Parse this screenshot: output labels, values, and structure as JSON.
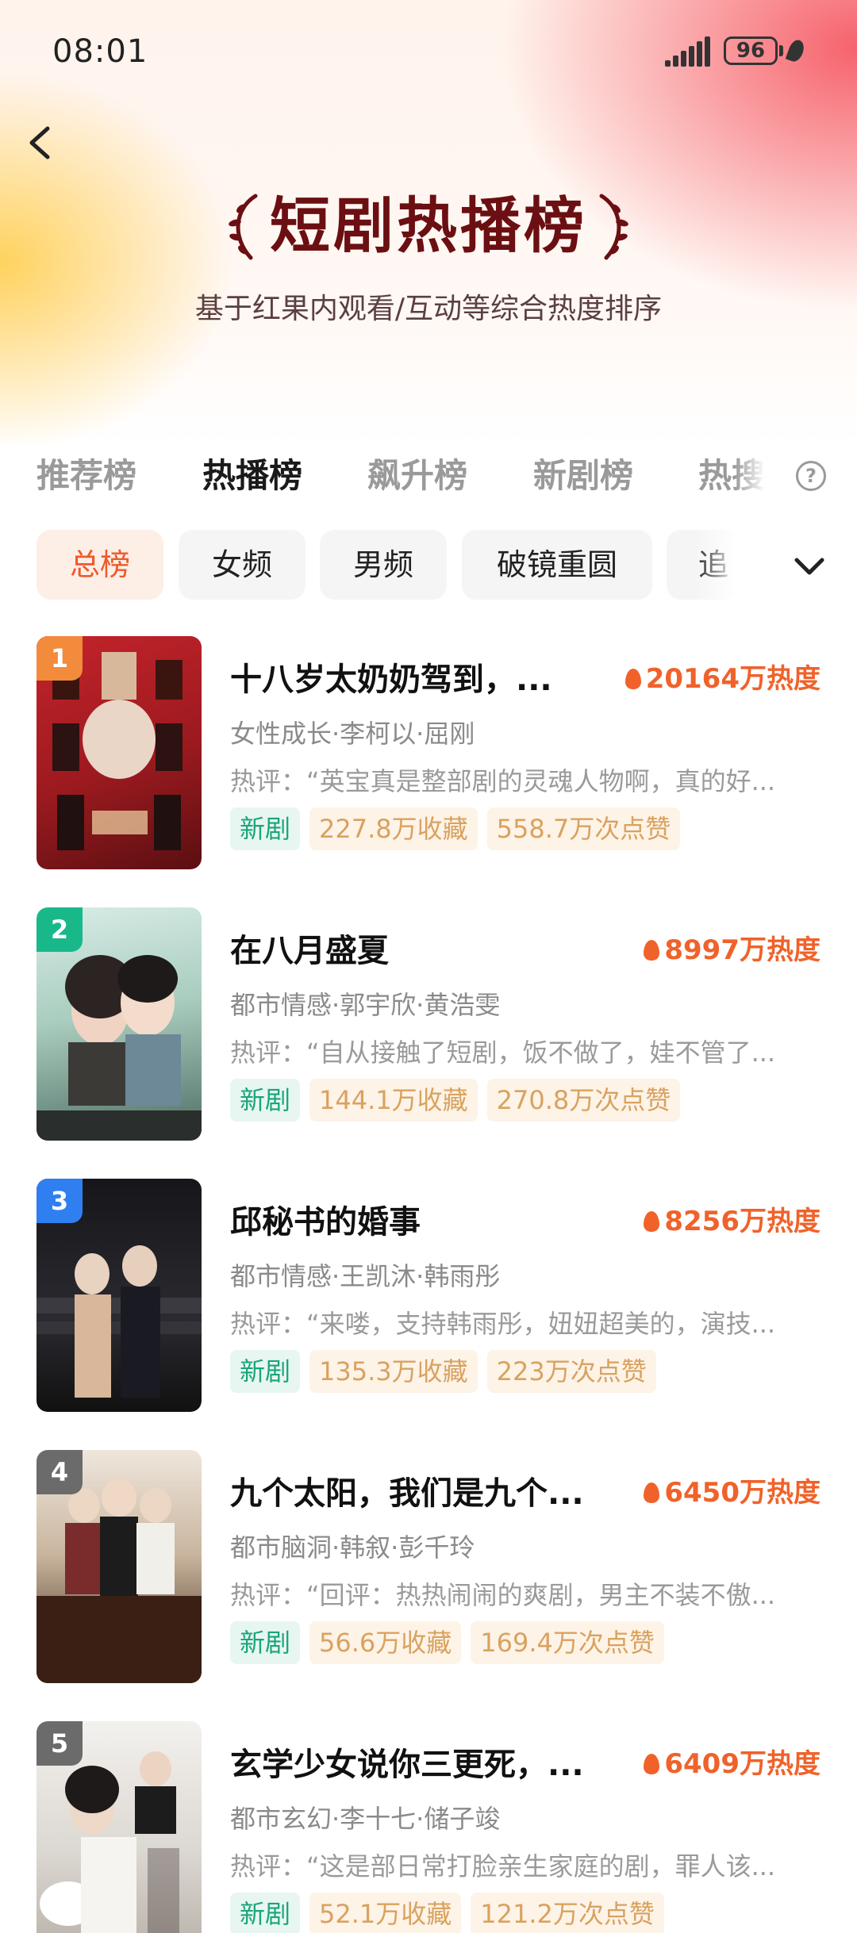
{
  "status_bar": {
    "time": "08:01",
    "battery": "96"
  },
  "header": {
    "title": "短剧热播榜",
    "subtitle": "基于红果内观看/互动等综合热度排序"
  },
  "tabs": [
    {
      "label": "推荐榜",
      "active": false
    },
    {
      "label": "热播榜",
      "active": true
    },
    {
      "label": "飙升榜",
      "active": false
    },
    {
      "label": "新剧榜",
      "active": false
    },
    {
      "label": "热搜",
      "active": false
    }
  ],
  "filters": [
    {
      "label": "总榜",
      "active": true
    },
    {
      "label": "女频",
      "active": false
    },
    {
      "label": "男频",
      "active": false
    },
    {
      "label": "破镜重圆",
      "active": false
    },
    {
      "label": "追",
      "active": false
    }
  ],
  "colors": {
    "accent": "#f0622a",
    "title_dark_red": "#6b0f12",
    "rank1": "#f28b3c",
    "rank2": "#19b88a",
    "rank3": "#2f7ff0",
    "rank_other": "#6b6b6b",
    "tag_new": "#1aa57a",
    "tag_stat": "#d9a25f"
  },
  "items": [
    {
      "rank": "1",
      "title": "十八岁太奶奶驾到，...",
      "heat": "20164万热度",
      "meta": "女性成长·李柯以·屈刚",
      "review": "热评：“英宝真是整部剧的灵魂人物啊，真的好...",
      "tags": [
        "新剧",
        "227.8万收藏",
        "558.7万次点赞"
      ]
    },
    {
      "rank": "2",
      "title": "在八月盛夏",
      "heat": "8997万热度",
      "meta": "都市情感·郭宇欣·黄浩雯",
      "review": "热评：“自从接触了短剧，饭不做了，娃不管了...",
      "tags": [
        "新剧",
        "144.1万收藏",
        "270.8万次点赞"
      ]
    },
    {
      "rank": "3",
      "title": "邱秘书的婚事",
      "heat": "8256万热度",
      "meta": "都市情感·王凯沐·韩雨彤",
      "review": "热评：“来喽，支持韩雨彤，妞妞超美的，演技...",
      "tags": [
        "新剧",
        "135.3万收藏",
        "223万次点赞"
      ]
    },
    {
      "rank": "4",
      "title": "九个太阳，我们是九个...",
      "heat": "6450万热度",
      "meta": "都市脑洞·韩叙·彭千玲",
      "review": "热评：“回评：热热闹闹的爽剧，男主不装不傲...",
      "tags": [
        "新剧",
        "56.6万收藏",
        "169.4万次点赞"
      ]
    },
    {
      "rank": "5",
      "title": "玄学少女说你三更死，...",
      "heat": "6409万热度",
      "meta": "都市玄幻·李十七·储子竣",
      "review": "热评：“这是部日常打脸亲生家庭的剧，罪人该...",
      "tags": [
        "新剧",
        "52.1万收藏",
        "121.2万次点赞"
      ]
    }
  ]
}
